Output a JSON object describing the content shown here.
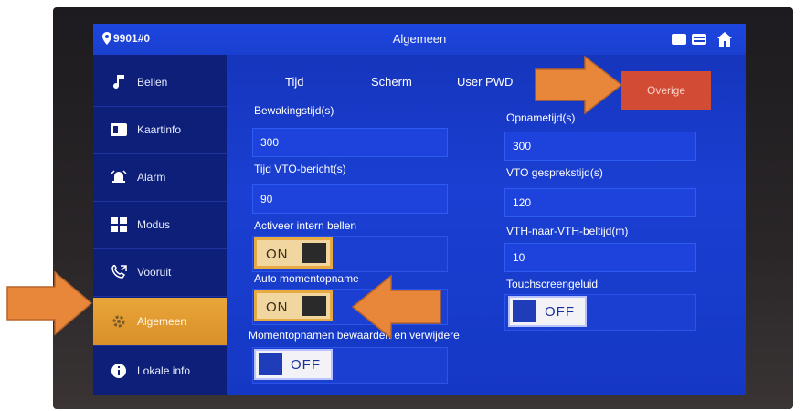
{
  "status_bar": {
    "device_id": "9901#0",
    "title": "Algemeen"
  },
  "sidebar": {
    "items": [
      {
        "label": "Bellen",
        "icon": "music-note-icon",
        "active": false
      },
      {
        "label": "Kaartinfo",
        "icon": "card-icon",
        "active": false
      },
      {
        "label": "Alarm",
        "icon": "alarm-icon",
        "active": false
      },
      {
        "label": "Modus",
        "icon": "grid-icon",
        "active": false
      },
      {
        "label": "Vooruit",
        "icon": "call-forward-icon",
        "active": false
      },
      {
        "label": "Algemeen",
        "icon": "gear-icon",
        "active": true
      },
      {
        "label": "Lokale info",
        "icon": "info-icon",
        "active": false
      }
    ]
  },
  "tabs": {
    "tijd": "Tijd",
    "scherm": "Scherm",
    "user_pwd": "User PWD",
    "overige": "Overige"
  },
  "fields": {
    "bewakingstijd": {
      "label": "Bewakingstijd(s)",
      "value": "300"
    },
    "tijd_vto_bericht": {
      "label": "Tijd VTO-bericht(s)",
      "value": "90"
    },
    "activeer_intern_bellen": {
      "label": "Activeer intern bellen",
      "state": "ON"
    },
    "auto_momentopname": {
      "label": "Auto momentopname",
      "state": "ON"
    },
    "momentopnamen": {
      "label": "Momentopnamen bewaarden en verwijdere",
      "state": "OFF"
    },
    "opnametijd": {
      "label": "Opnametijd(s)",
      "value": "300"
    },
    "vto_gesprekstijd": {
      "label": "VTO gesprekstijd(s)",
      "value": "120"
    },
    "vth_naar_vth": {
      "label": "VTH-naar-VTH-beltijd(m)",
      "value": "10"
    },
    "touchscreengeluid": {
      "label": "Touchscreengeluid",
      "state": "OFF"
    }
  },
  "colors": {
    "screen_blue": "#1a3fd2",
    "active_orange": "#e9a63a",
    "other_tab_red": "#d14b35",
    "annotation_arrow": "#e8863a"
  }
}
